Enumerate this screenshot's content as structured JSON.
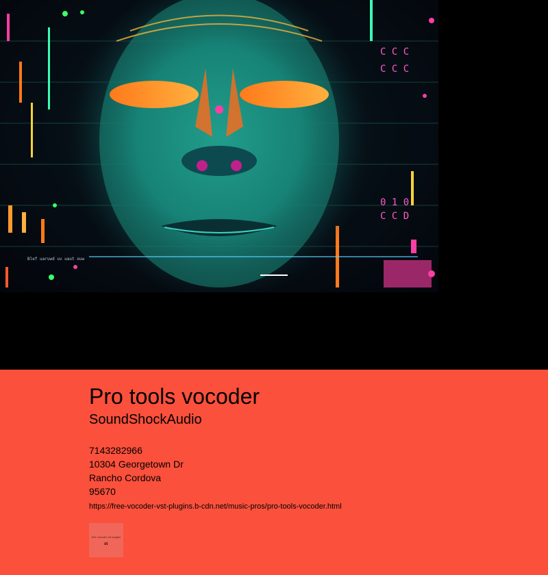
{
  "hero": {
    "image_name": "ai-face-circuit-artwork"
  },
  "footer": {
    "title": "Pro tools vocoder",
    "brand": "SoundShockAudio",
    "phone": "7143282966",
    "street": "10304 Georgetown Dr",
    "city": "Rancho Cordova",
    "zip": "95670",
    "url": "https://free-vocoder-vst-plugins.b-cdn.net/music-pros/pro-tools-vocoder.html",
    "thumbnail_text": "free vocoder vst plugins",
    "thumbnail_mark": "st"
  },
  "colors": {
    "footer_background": "#fa503c",
    "page_background": "#000000",
    "text": "#000000"
  }
}
